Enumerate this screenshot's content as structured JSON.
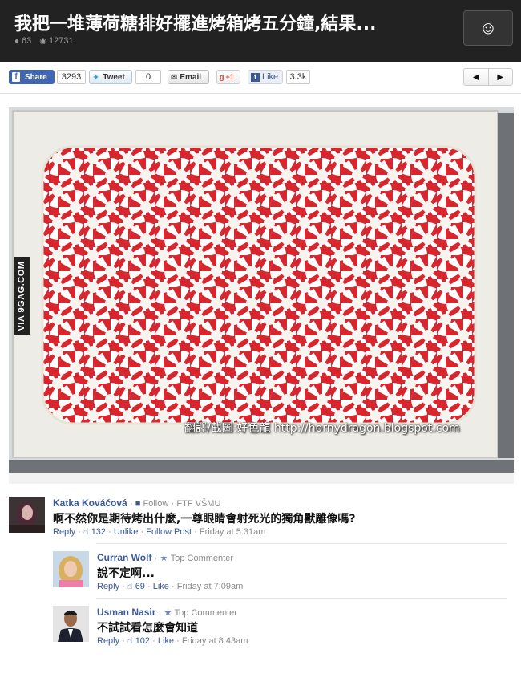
{
  "header": {
    "title": "我把一堆薄荷糖排好擺進烤箱烤五分鐘,結果...",
    "comments_count": "63",
    "views_count": "12731",
    "smile_icon": "smiley-icon"
  },
  "sharebar": {
    "fb_share_label": "Share",
    "fb_share_count": "3293",
    "tweet_label": "Tweet",
    "tweet_count": "0",
    "email_label": "Email",
    "gplus_label": "+1",
    "like_label": "Like",
    "like_count": "3.3k"
  },
  "photo": {
    "side_watermark": "VIA 9GAG.COM",
    "credit": "翻譯/截圖:好色龍  http://hornydragon.blogspot.com",
    "candy_red": "#d8262e",
    "tray_color": "#f3f1ec"
  },
  "comments": [
    {
      "name": "Katka Kováčová",
      "follow": "Follow",
      "meta": "FTF VŠMU",
      "text": "啊不然你是期待烤出什麼,一尊眼睛會射死光的獨角獸雕像嗎?",
      "reply": "Reply",
      "likes": "132",
      "like_action": "Unlike",
      "follow_post": "Follow Post",
      "time": "Friday at 5:31am"
    },
    {
      "name": "Curran Wolf",
      "meta": "Top Commenter",
      "text": "說不定啊...",
      "reply": "Reply",
      "likes": "69",
      "like_action": "Like",
      "time": "Friday at 7:09am"
    },
    {
      "name": "Usman Nasir",
      "meta": "Top Commenter",
      "text": "不試試看怎麼會知道",
      "reply": "Reply",
      "likes": "102",
      "like_action": "Like",
      "time": "Friday at 8:43am"
    }
  ]
}
